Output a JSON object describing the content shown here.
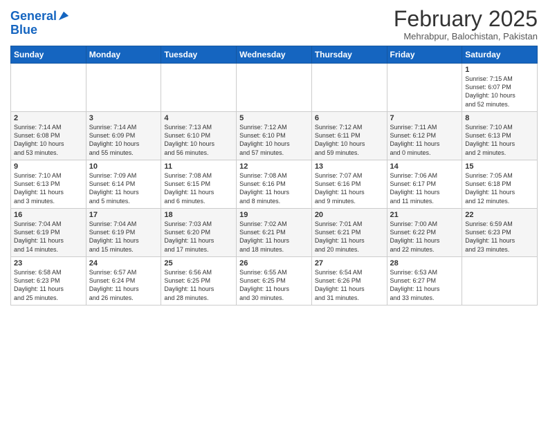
{
  "header": {
    "logo_line1": "General",
    "logo_line2": "Blue",
    "month_title": "February 2025",
    "location": "Mehrabpur, Balochistan, Pakistan"
  },
  "weekdays": [
    "Sunday",
    "Monday",
    "Tuesday",
    "Wednesday",
    "Thursday",
    "Friday",
    "Saturday"
  ],
  "weeks": [
    [
      {
        "day": "",
        "info": ""
      },
      {
        "day": "",
        "info": ""
      },
      {
        "day": "",
        "info": ""
      },
      {
        "day": "",
        "info": ""
      },
      {
        "day": "",
        "info": ""
      },
      {
        "day": "",
        "info": ""
      },
      {
        "day": "1",
        "info": "Sunrise: 7:15 AM\nSunset: 6:07 PM\nDaylight: 10 hours\nand 52 minutes."
      }
    ],
    [
      {
        "day": "2",
        "info": "Sunrise: 7:14 AM\nSunset: 6:08 PM\nDaylight: 10 hours\nand 53 minutes."
      },
      {
        "day": "3",
        "info": "Sunrise: 7:14 AM\nSunset: 6:09 PM\nDaylight: 10 hours\nand 55 minutes."
      },
      {
        "day": "4",
        "info": "Sunrise: 7:13 AM\nSunset: 6:10 PM\nDaylight: 10 hours\nand 56 minutes."
      },
      {
        "day": "5",
        "info": "Sunrise: 7:12 AM\nSunset: 6:10 PM\nDaylight: 10 hours\nand 57 minutes."
      },
      {
        "day": "6",
        "info": "Sunrise: 7:12 AM\nSunset: 6:11 PM\nDaylight: 10 hours\nand 59 minutes."
      },
      {
        "day": "7",
        "info": "Sunrise: 7:11 AM\nSunset: 6:12 PM\nDaylight: 11 hours\nand 0 minutes."
      },
      {
        "day": "8",
        "info": "Sunrise: 7:10 AM\nSunset: 6:13 PM\nDaylight: 11 hours\nand 2 minutes."
      }
    ],
    [
      {
        "day": "9",
        "info": "Sunrise: 7:10 AM\nSunset: 6:13 PM\nDaylight: 11 hours\nand 3 minutes."
      },
      {
        "day": "10",
        "info": "Sunrise: 7:09 AM\nSunset: 6:14 PM\nDaylight: 11 hours\nand 5 minutes."
      },
      {
        "day": "11",
        "info": "Sunrise: 7:08 AM\nSunset: 6:15 PM\nDaylight: 11 hours\nand 6 minutes."
      },
      {
        "day": "12",
        "info": "Sunrise: 7:08 AM\nSunset: 6:16 PM\nDaylight: 11 hours\nand 8 minutes."
      },
      {
        "day": "13",
        "info": "Sunrise: 7:07 AM\nSunset: 6:16 PM\nDaylight: 11 hours\nand 9 minutes."
      },
      {
        "day": "14",
        "info": "Sunrise: 7:06 AM\nSunset: 6:17 PM\nDaylight: 11 hours\nand 11 minutes."
      },
      {
        "day": "15",
        "info": "Sunrise: 7:05 AM\nSunset: 6:18 PM\nDaylight: 11 hours\nand 12 minutes."
      }
    ],
    [
      {
        "day": "16",
        "info": "Sunrise: 7:04 AM\nSunset: 6:19 PM\nDaylight: 11 hours\nand 14 minutes."
      },
      {
        "day": "17",
        "info": "Sunrise: 7:04 AM\nSunset: 6:19 PM\nDaylight: 11 hours\nand 15 minutes."
      },
      {
        "day": "18",
        "info": "Sunrise: 7:03 AM\nSunset: 6:20 PM\nDaylight: 11 hours\nand 17 minutes."
      },
      {
        "day": "19",
        "info": "Sunrise: 7:02 AM\nSunset: 6:21 PM\nDaylight: 11 hours\nand 18 minutes."
      },
      {
        "day": "20",
        "info": "Sunrise: 7:01 AM\nSunset: 6:21 PM\nDaylight: 11 hours\nand 20 minutes."
      },
      {
        "day": "21",
        "info": "Sunrise: 7:00 AM\nSunset: 6:22 PM\nDaylight: 11 hours\nand 22 minutes."
      },
      {
        "day": "22",
        "info": "Sunrise: 6:59 AM\nSunset: 6:23 PM\nDaylight: 11 hours\nand 23 minutes."
      }
    ],
    [
      {
        "day": "23",
        "info": "Sunrise: 6:58 AM\nSunset: 6:23 PM\nDaylight: 11 hours\nand 25 minutes."
      },
      {
        "day": "24",
        "info": "Sunrise: 6:57 AM\nSunset: 6:24 PM\nDaylight: 11 hours\nand 26 minutes."
      },
      {
        "day": "25",
        "info": "Sunrise: 6:56 AM\nSunset: 6:25 PM\nDaylight: 11 hours\nand 28 minutes."
      },
      {
        "day": "26",
        "info": "Sunrise: 6:55 AM\nSunset: 6:25 PM\nDaylight: 11 hours\nand 30 minutes."
      },
      {
        "day": "27",
        "info": "Sunrise: 6:54 AM\nSunset: 6:26 PM\nDaylight: 11 hours\nand 31 minutes."
      },
      {
        "day": "28",
        "info": "Sunrise: 6:53 AM\nSunset: 6:27 PM\nDaylight: 11 hours\nand 33 minutes."
      },
      {
        "day": "",
        "info": ""
      }
    ]
  ]
}
